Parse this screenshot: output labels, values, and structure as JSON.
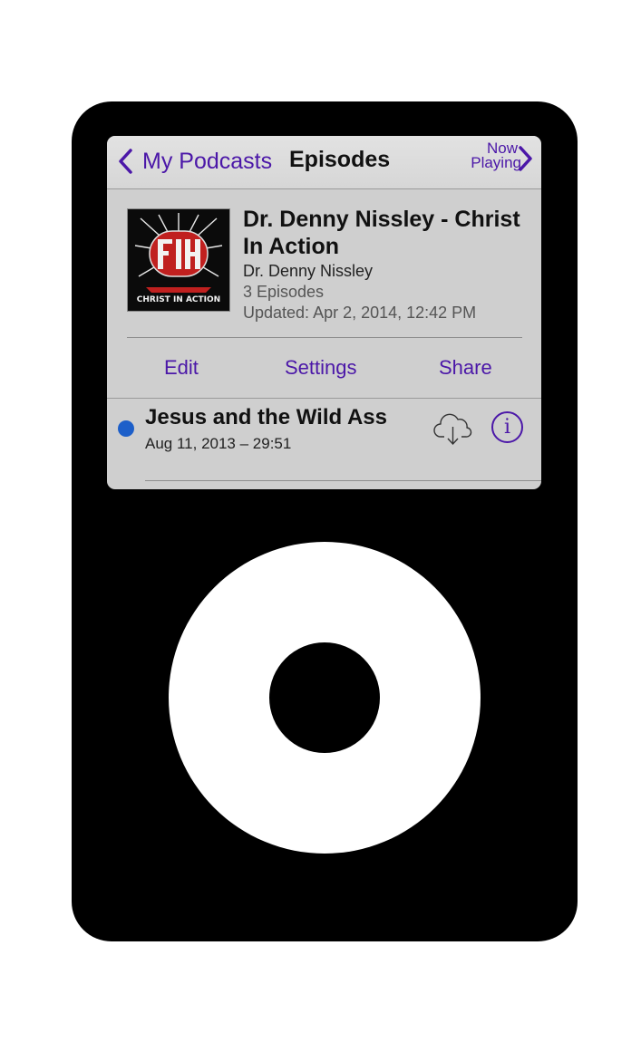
{
  "nav": {
    "back_label": "My Podcasts",
    "title": "Episodes",
    "now_playing_line1": "Now",
    "now_playing_line2": "Playing"
  },
  "podcast": {
    "artwork_text": "CHRIST IN ACTION",
    "title": "Dr. Denny Nissley - Christ In Action",
    "author": "Dr. Denny Nissley",
    "episode_count": "3 Episodes",
    "updated": "Updated: Apr 2, 2014, 12:42 PM"
  },
  "actions": {
    "edit": "Edit",
    "settings": "Settings",
    "share": "Share"
  },
  "episodes": [
    {
      "title": "Jesus and the Wild Ass",
      "meta": "Aug 11, 2013 – 29:51",
      "unplayed": true
    }
  ],
  "icons": {
    "back": "chevron-left-icon",
    "forward": "chevron-right-icon",
    "download": "cloud-download-icon",
    "info": "info-icon",
    "unplayed": "unplayed-dot-icon"
  },
  "colors": {
    "accent": "#4b17a8",
    "unplayed_dot": "#1d5fc9",
    "device_body": "#000000",
    "screen_bg": "#cfcfcf",
    "wheel": "#ffffff"
  }
}
